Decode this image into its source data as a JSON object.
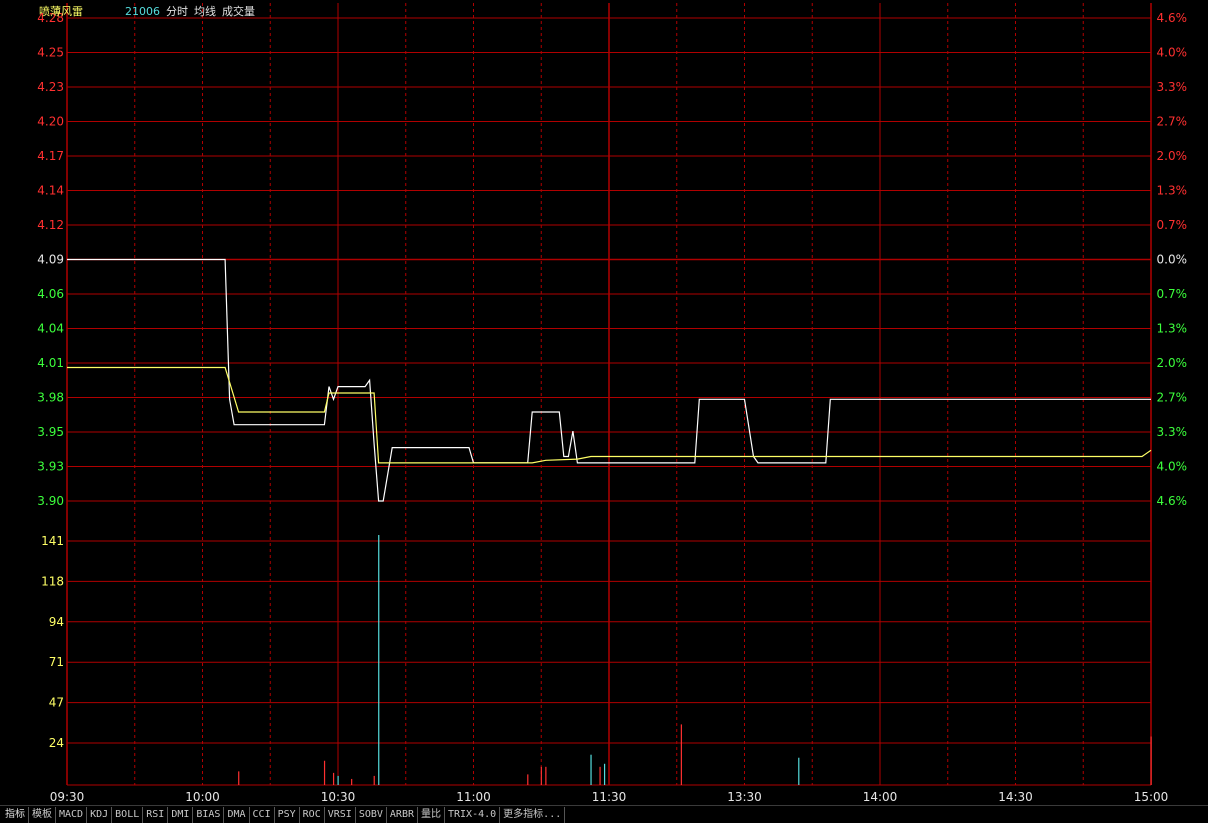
{
  "header": {
    "stock_name": "喷薄风雷",
    "stock_code": "21006",
    "indicators": [
      "分时",
      "均线",
      "成交量"
    ]
  },
  "colors": {
    "up": "#ff3030",
    "down": "#3cff3c",
    "neutral": "#e6e6e6",
    "grid": "#b00000",
    "price_line": "#ffffff",
    "avg_line": "#ffff66",
    "volume_labels": "#ffff66"
  },
  "bottom_tabs": [
    "指标",
    "模板",
    "MACD",
    "KDJ",
    "BOLL",
    "RSI",
    "DMI",
    "BIAS",
    "DMA",
    "CCI",
    "PSY",
    "ROC",
    "VRSI",
    "SOBV",
    "ARBR",
    "量比",
    "TRIX-4.0",
    "更多指标..."
  ],
  "chart_data": {
    "type": "line",
    "prev_close": 4.09,
    "price_axis": {
      "ticks": [
        "4.28",
        "4.25",
        "4.23",
        "4.20",
        "4.17",
        "4.14",
        "4.12",
        "4.09",
        "4.06",
        "4.04",
        "4.01",
        "3.98",
        "3.95",
        "3.93",
        "3.90"
      ],
      "percent_ticks": [
        "4.6%",
        "4.0%",
        "3.3%",
        "2.7%",
        "2.0%",
        "1.3%",
        "0.7%",
        "0.0%",
        "0.7%",
        "1.3%",
        "2.0%",
        "2.7%",
        "3.3%",
        "4.0%",
        "4.6%"
      ],
      "ylim": [
        3.9,
        4.28
      ]
    },
    "volume_axis": {
      "ticks": [
        "141",
        "118",
        "94",
        "71",
        "47",
        "24"
      ],
      "ylim": [
        0,
        165
      ]
    },
    "time_labels": [
      "09:30",
      "10:00",
      "10:30",
      "11:00",
      "11:30",
      "13:30",
      "14:00",
      "14:30",
      "15:00"
    ],
    "session_minutes": 240,
    "series": [
      {
        "name": "price",
        "points": [
          [
            0,
            4.09
          ],
          [
            35,
            4.09
          ],
          [
            36,
            3.98
          ],
          [
            37,
            3.96
          ],
          [
            57,
            3.96
          ],
          [
            58,
            3.99
          ],
          [
            59,
            3.98
          ],
          [
            60,
            3.99
          ],
          [
            65,
            3.99
          ],
          [
            66,
            3.99
          ],
          [
            67,
            3.995
          ],
          [
            68,
            3.945
          ],
          [
            69,
            3.9
          ],
          [
            70,
            3.9
          ],
          [
            72,
            3.942
          ],
          [
            84,
            3.942
          ],
          [
            89,
            3.942
          ],
          [
            90,
            3.93
          ],
          [
            99,
            3.93
          ],
          [
            102,
            3.93
          ],
          [
            103,
            3.97
          ],
          [
            106,
            3.97
          ],
          [
            109,
            3.97
          ],
          [
            110,
            3.935
          ],
          [
            111,
            3.935
          ],
          [
            112,
            3.955
          ],
          [
            113,
            3.93
          ],
          [
            125,
            3.93
          ],
          [
            139,
            3.93
          ],
          [
            140,
            3.98
          ],
          [
            148,
            3.98
          ],
          [
            150,
            3.98
          ],
          [
            152,
            3.935
          ],
          [
            153,
            3.93
          ],
          [
            166,
            3.93
          ],
          [
            168,
            3.93
          ],
          [
            169,
            3.98
          ],
          [
            240,
            3.98
          ]
        ]
      },
      {
        "name": "avg",
        "points": [
          [
            0,
            4.005
          ],
          [
            35,
            4.005
          ],
          [
            38,
            3.97
          ],
          [
            57,
            3.97
          ],
          [
            58,
            3.985
          ],
          [
            59,
            3.985
          ],
          [
            68,
            3.985
          ],
          [
            69,
            3.93
          ],
          [
            85,
            3.93
          ],
          [
            103,
            3.93
          ],
          [
            106,
            3.932
          ],
          [
            113,
            3.933
          ],
          [
            116,
            3.935
          ],
          [
            164,
            3.935
          ],
          [
            167,
            3.935
          ],
          [
            238,
            3.935
          ],
          [
            240,
            3.94
          ]
        ]
      }
    ],
    "volumes": [
      [
        38,
        9,
        "up"
      ],
      [
        57,
        16,
        "up"
      ],
      [
        59,
        8,
        "up"
      ],
      [
        60,
        6,
        "down"
      ],
      [
        63,
        4,
        "up"
      ],
      [
        68,
        6,
        "up"
      ],
      [
        69,
        165,
        "down"
      ],
      [
        102,
        7,
        "up"
      ],
      [
        105,
        12,
        "up"
      ],
      [
        106,
        12,
        "up"
      ],
      [
        116,
        20,
        "down"
      ],
      [
        118,
        12,
        "up"
      ],
      [
        119,
        14,
        "down"
      ],
      [
        136,
        40,
        "up"
      ],
      [
        162,
        18,
        "down"
      ],
      [
        240,
        32,
        "up"
      ]
    ]
  }
}
